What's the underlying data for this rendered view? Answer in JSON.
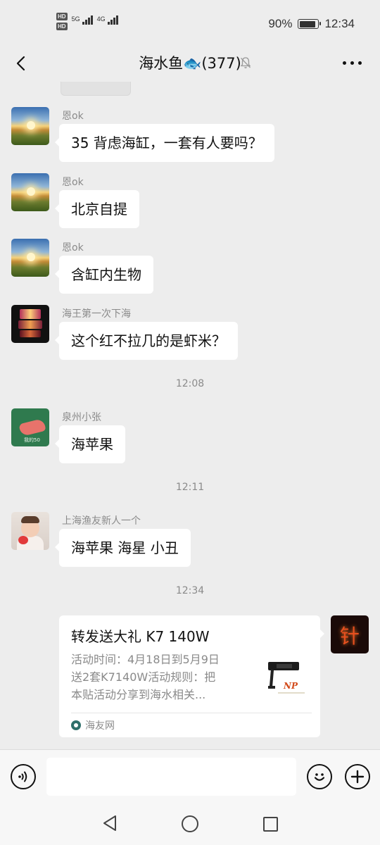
{
  "status_bar": {
    "hd1": "HD",
    "hd2": "HD",
    "net1": "5G",
    "net2": "4G",
    "battery_text": "90%",
    "battery_level": 0.9,
    "time": "12:34"
  },
  "header": {
    "title": "海水鱼🐟(377)",
    "icons": [
      "back-arrow-icon",
      "mute-bell-icon",
      "more-dots-icon"
    ]
  },
  "messages": [
    {
      "sender": "恩ok",
      "text": "35 背虑海缸，一套有人要吗？"
    },
    {
      "sender": "恩ok",
      "text": "北京自提"
    },
    {
      "sender": "恩ok",
      "text": "含缸内生物"
    },
    {
      "sender": "海王第一次下海",
      "text": "这个红不拉几的是虾米？"
    },
    {
      "sender": "泉州小张",
      "text": "海苹果"
    },
    {
      "sender": "上海渔友新人一个",
      "text": "海苹果 海星 小丑"
    }
  ],
  "timestamps": [
    "12:08",
    "12:11",
    "12:34"
  ],
  "avatar_texts": {
    "green": "我的50",
    "self": "针"
  },
  "link_card": {
    "title": "转发送大礼 K7 140W",
    "desc_lines": [
      "活动时间：4月18日到5月9日",
      "送2套K7140W活动规则：把",
      "本贴活动分享到海水相关..."
    ],
    "source": "海友网",
    "thumb_text": "NP"
  },
  "input": {
    "placeholder": ""
  },
  "colors": {
    "background": "#ededed",
    "bubble": "#ffffff",
    "secondary_text": "#8a8a8a"
  }
}
